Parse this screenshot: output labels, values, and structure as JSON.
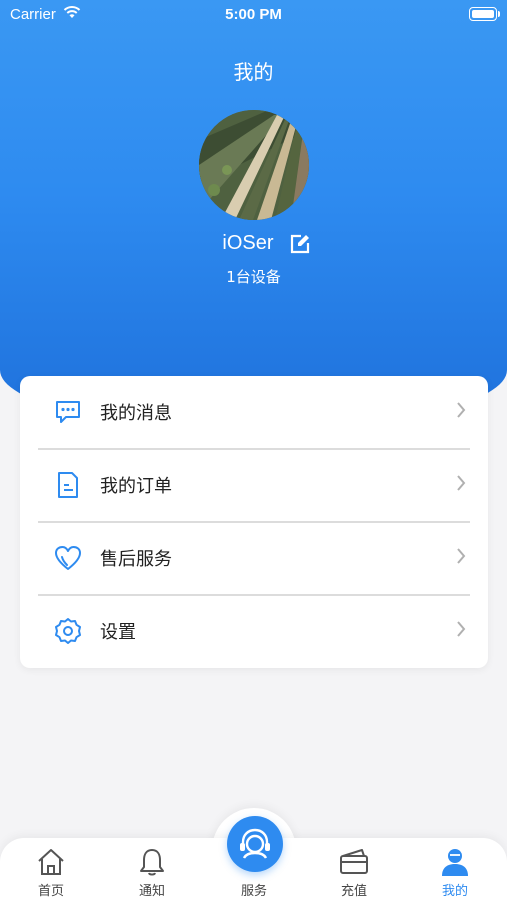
{
  "status_bar": {
    "carrier": "Carrier",
    "time": "5:00 PM"
  },
  "header": {
    "title": "我的"
  },
  "profile": {
    "username": "iOSer",
    "device_count": "1台设备"
  },
  "menu": {
    "items": [
      {
        "label": "我的消息",
        "icon": "message-icon"
      },
      {
        "label": "我的订单",
        "icon": "document-icon"
      },
      {
        "label": "售后服务",
        "icon": "heart-icon"
      },
      {
        "label": "设置",
        "icon": "gear-icon"
      }
    ]
  },
  "tabbar": {
    "tabs": [
      {
        "label": "首页",
        "icon": "home-icon"
      },
      {
        "label": "通知",
        "icon": "bell-icon"
      },
      {
        "label": "服务",
        "icon": "headset-icon"
      },
      {
        "label": "充值",
        "icon": "card-icon"
      },
      {
        "label": "我的",
        "icon": "person-icon",
        "active": true
      }
    ]
  },
  "colors": {
    "accent": "#2e8bf0",
    "background": "#f4f4f6"
  }
}
